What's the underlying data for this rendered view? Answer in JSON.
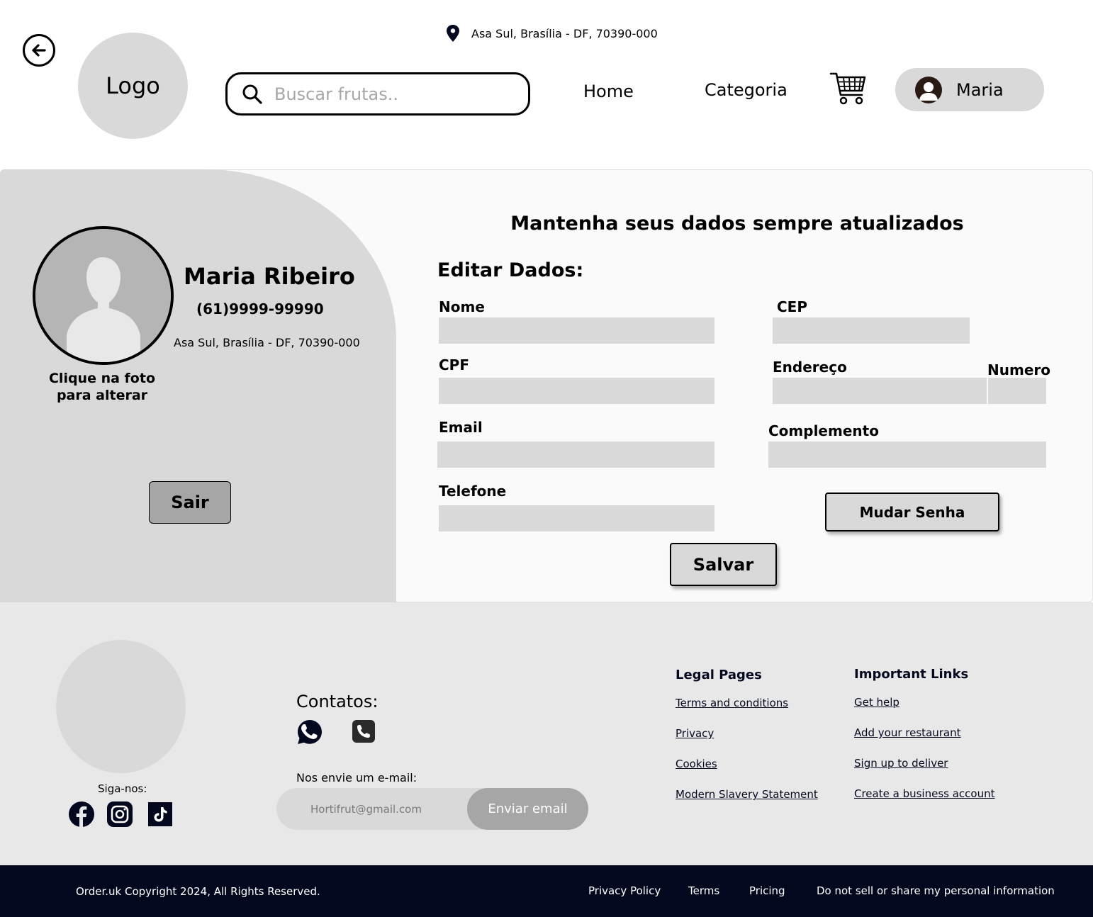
{
  "header": {
    "location": "Asa Sul, Brasília - DF, 70390-000",
    "logo_text": "Logo",
    "search_placeholder": "Buscar frutas..",
    "nav": {
      "home": "Home",
      "category": "Categoria"
    },
    "user_name": "Maria"
  },
  "profile": {
    "name": "Maria Ribeiro",
    "phone": "(61)9999-99990",
    "address": "Asa Sul, Brasília - DF, 70390-000",
    "photo_hint": "Clique na foto para alterar",
    "logout_label": "Sair"
  },
  "form": {
    "heading": "Mantenha seus dados sempre atualizados",
    "title": "Editar Dados:",
    "labels": {
      "nome": "Nome",
      "cpf": "CPF",
      "email": "Email",
      "telefone": "Telefone",
      "cep": "CEP",
      "endereco": "Endereço",
      "numero": "Numero",
      "complemento": "Complemento"
    },
    "change_password_label": "Mudar Senha",
    "save_label": "Salvar"
  },
  "footer": {
    "follow_label": "Siga-nos:",
    "contacts_title": "Contatos:",
    "email_label": "Nos envie um e-mail:",
    "email_placeholder": "Hortifrut@gmail.com",
    "email_button": "Enviar email",
    "legal": {
      "title": "Legal Pages",
      "links": [
        "Terms and conditions",
        "Privacy",
        "Cookies",
        "Modern Slavery Statement"
      ]
    },
    "important": {
      "title": "Important Links",
      "links": [
        "Get help",
        "Add your restaurant",
        "Sign up to deliver",
        "Create a business account"
      ]
    },
    "copyright": "Order.uk Copyright 2024, All Rights Reserved.",
    "bottom_links": [
      "Privacy Policy",
      "Terms",
      "Pricing",
      "Do not sell or share my personal information"
    ]
  },
  "icons": [
    "back-arrow-icon",
    "location-pin-icon",
    "search-icon",
    "cart-icon",
    "user-avatar-icon",
    "whatsapp-icon",
    "phone-icon",
    "facebook-icon",
    "instagram-icon",
    "tiktok-icon"
  ],
  "colors": {
    "panel_gray": "#d9d9d9",
    "button_gray": "#a6a6a6",
    "footer_bg": "#e8e8e8",
    "bottom_bar": "#03081f"
  }
}
